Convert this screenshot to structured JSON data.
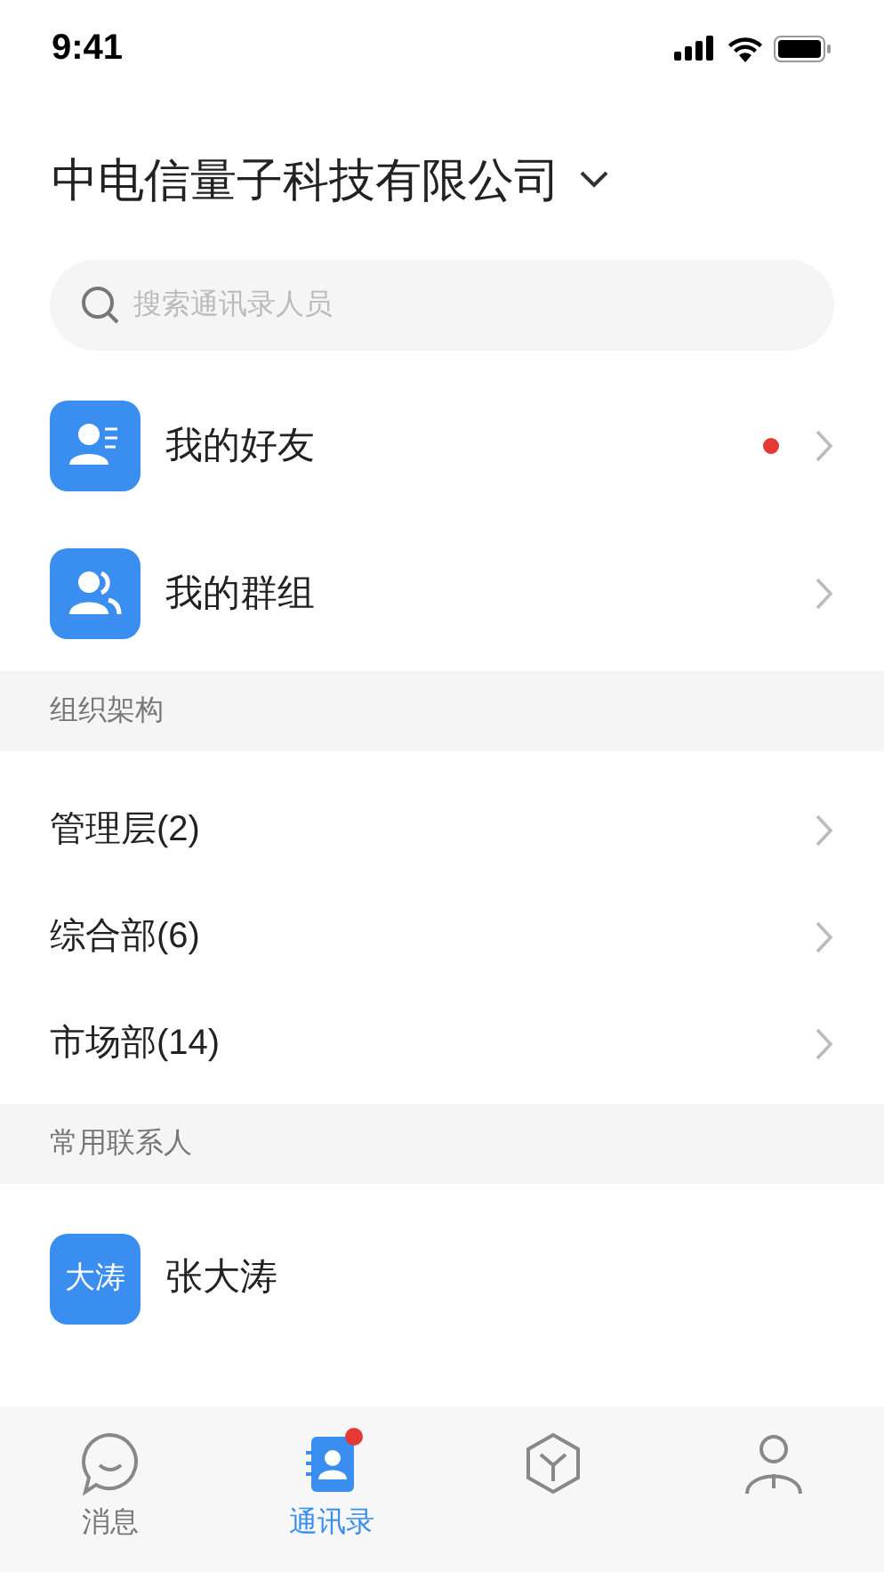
{
  "status_bar": {
    "time": "9:41"
  },
  "header": {
    "title": "中电信量子科技有限公司"
  },
  "search": {
    "placeholder": "搜索通讯录人员"
  },
  "quick_links": [
    {
      "kind": "friends",
      "label": "我的好友",
      "unread": true
    },
    {
      "kind": "groups",
      "label": "我的群组",
      "unread": false
    }
  ],
  "org_section": {
    "title": "组织架构",
    "items": [
      {
        "label": "管理层(2)"
      },
      {
        "label": "综合部(6)"
      },
      {
        "label": "市场部(14)"
      }
    ]
  },
  "contacts_section": {
    "title": "常用联系人",
    "items": [
      {
        "avatar_text": "大涛",
        "name": "张大涛"
      }
    ]
  },
  "tab_bar": [
    {
      "kind": "messages",
      "label": "消息",
      "selected": false,
      "badge": false
    },
    {
      "kind": "contacts",
      "label": "通讯录",
      "selected": true,
      "badge": true
    },
    {
      "kind": "workbench",
      "selected": false,
      "badge": false
    },
    {
      "kind": "profile",
      "selected": false,
      "badge": false
    }
  ]
}
